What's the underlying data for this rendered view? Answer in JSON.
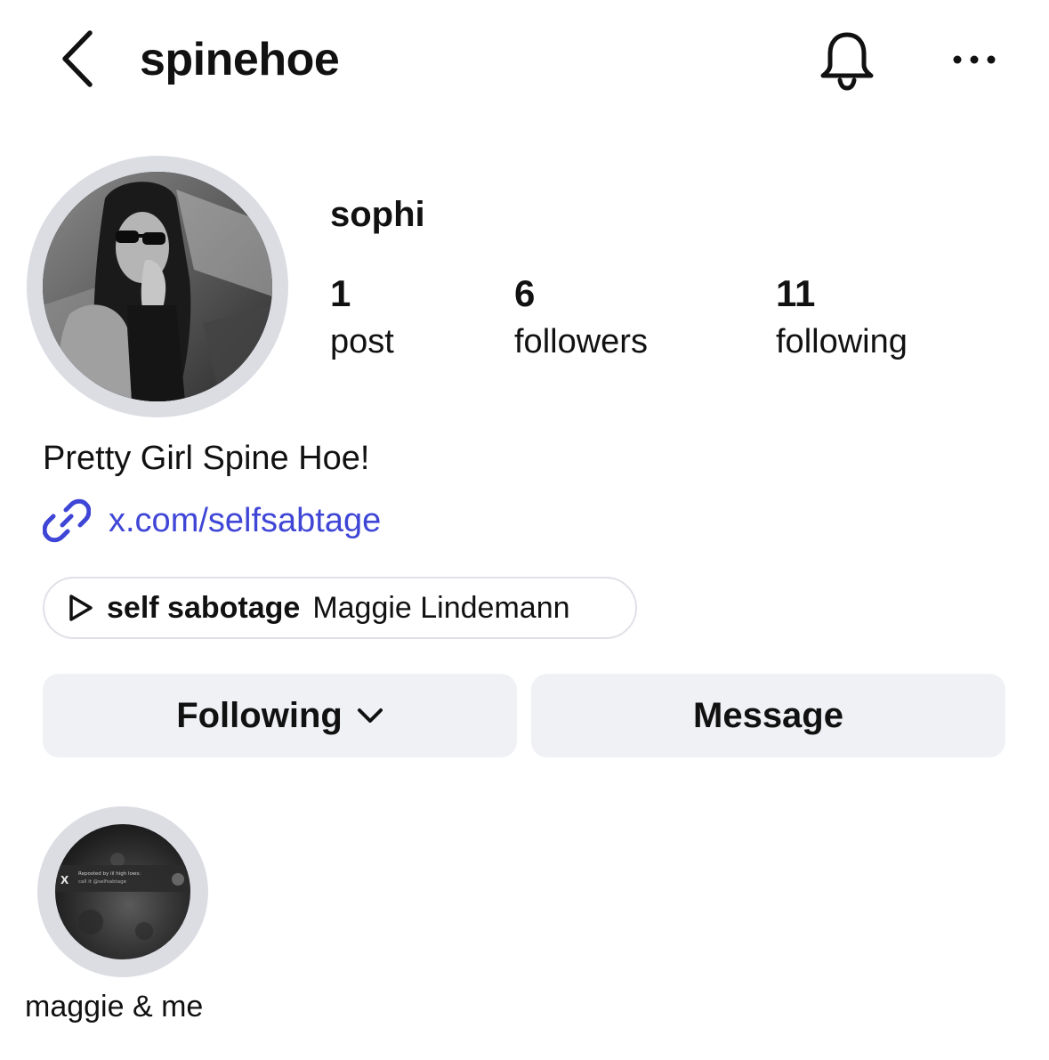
{
  "header": {
    "username": "spinehoe",
    "back_icon": "chevron-left-icon",
    "notifications_icon": "bell-icon",
    "more_icon": "more-horizontal-icon"
  },
  "profile": {
    "display_name": "sophi",
    "stats": [
      {
        "count": "1",
        "label": "post"
      },
      {
        "count": "6",
        "label": "followers"
      },
      {
        "count": "11",
        "label": "following"
      }
    ],
    "bio": "Pretty Girl Spine Hoe!",
    "link": "x.com/selfsabtage",
    "link_color": "#3f46d6"
  },
  "music": {
    "title": "self sabotage",
    "artist": "Maggie Lindemann"
  },
  "actions": {
    "following_label": "Following",
    "message_label": "Message"
  },
  "highlights": [
    {
      "label": "maggie & me",
      "thumb_text_line1": "Reposted by lil high lows:",
      "thumb_text_line2": "call it @selfsabtage"
    }
  ]
}
